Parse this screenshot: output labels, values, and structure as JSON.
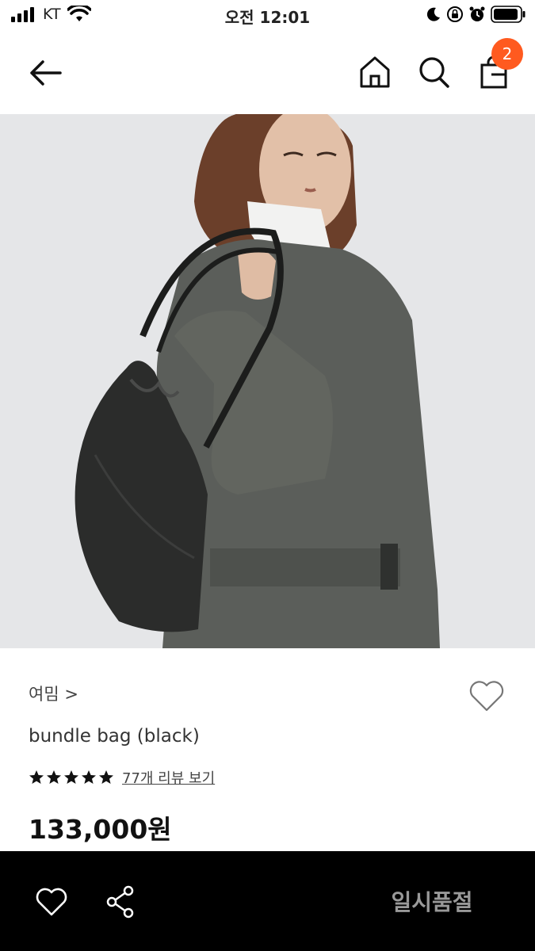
{
  "status": {
    "carrier": "KT",
    "time": "오전 12:01",
    "icons": [
      "signal-icon",
      "wifi-icon",
      "moon-icon",
      "rotation-lock-icon",
      "alarm-icon",
      "battery-icon"
    ]
  },
  "nav": {
    "icons": [
      "back-arrow-icon",
      "home-icon",
      "search-icon",
      "shopping-bag-icon"
    ],
    "cart_count": "2",
    "badge_color": "#ff5a1f"
  },
  "product": {
    "brand": "여밈 >",
    "name": "bundle bag (black)",
    "rating_stars": 5,
    "review_link": "77개 리뷰 보기",
    "price": "133,000원",
    "image_subject": "photo-model-with-black-bag"
  },
  "bottom_bar": {
    "icons": [
      "heart-icon",
      "share-icon"
    ],
    "status_label": "일시품절"
  }
}
